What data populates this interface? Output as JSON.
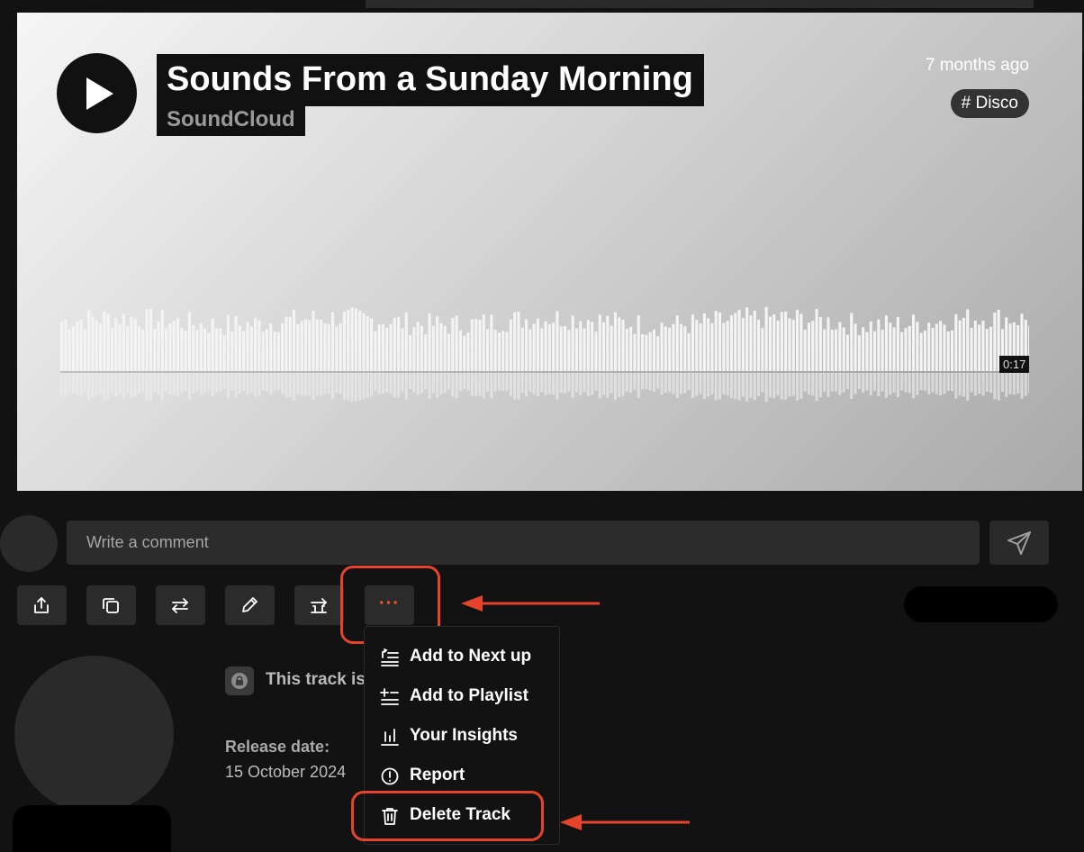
{
  "track": {
    "title": "Sounds From a Sunday Morning",
    "artist": "SoundCloud",
    "posted": "7 months ago",
    "genre_tag": "# Disco",
    "waveform_time": "0:17"
  },
  "comment": {
    "placeholder": "Write a comment"
  },
  "details": {
    "privacy_text": "This track is",
    "release_label": "Release date:",
    "release_value": "15 October 2024"
  },
  "toolbar": {
    "more_label": "···"
  },
  "menu": {
    "items": [
      {
        "label": "Add to Next up",
        "icon": "add-next-icon"
      },
      {
        "label": "Add to Playlist",
        "icon": "add-playlist-icon"
      },
      {
        "label": "Your Insights",
        "icon": "insights-icon"
      },
      {
        "label": "Report",
        "icon": "report-icon"
      },
      {
        "label": "Delete Track",
        "icon": "trash-icon"
      }
    ]
  },
  "colors": {
    "accent": "#ff5a1f",
    "annotation": "#e5432b"
  }
}
